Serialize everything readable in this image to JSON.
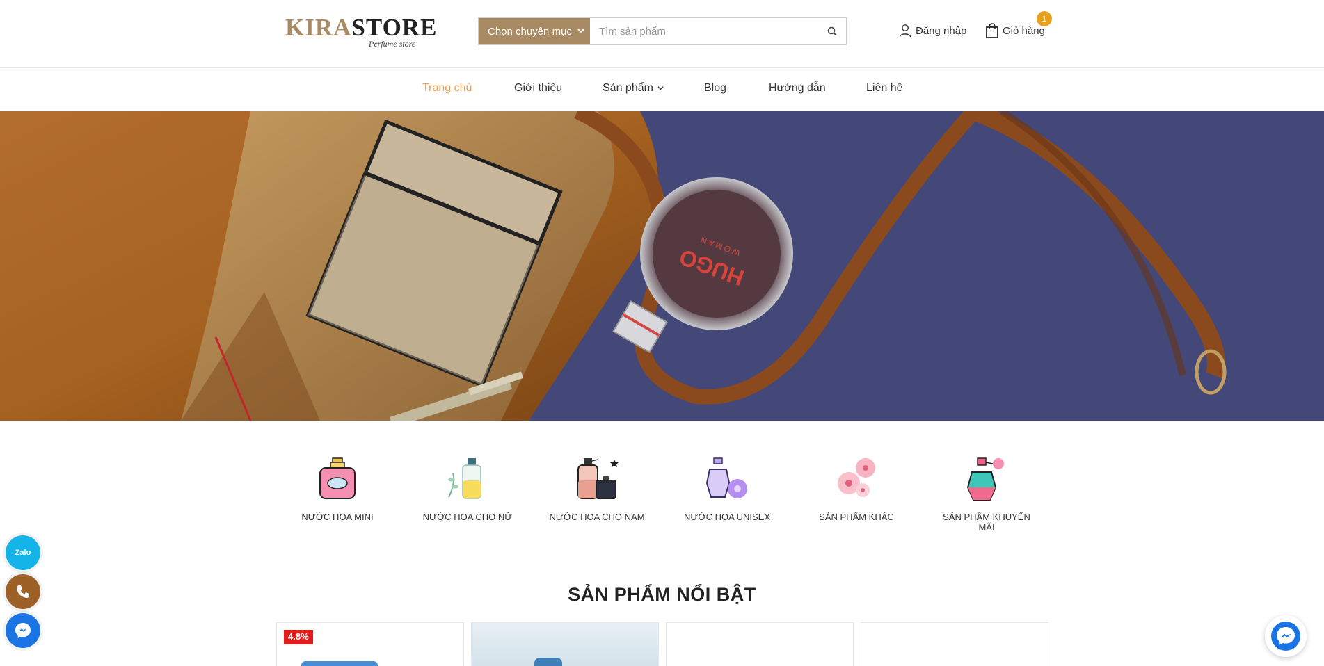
{
  "header": {
    "logo_main_1": "KIRA",
    "logo_main_2": "STORE",
    "logo_sub": "Perfume store",
    "search_category": "Chọn chuyên mục",
    "search_placeholder": "Tìm sản phẩm",
    "login_label": "Đăng nhập",
    "cart_label": "Giỏ hàng",
    "cart_count": "1"
  },
  "nav": {
    "items": [
      {
        "label": "Trang chủ"
      },
      {
        "label": "Giới thiệu"
      },
      {
        "label": "Sản phẩm"
      },
      {
        "label": "Blog"
      },
      {
        "label": "Hướng dẫn"
      },
      {
        "label": "Liên hệ"
      }
    ]
  },
  "hero": {
    "bottle_brand": "HUGO",
    "bottle_sub": "WOMAN"
  },
  "categories": [
    {
      "label": "Nước hoa mini",
      "icon": "perfume-mini-icon"
    },
    {
      "label": "Nước hoa cho nữ",
      "icon": "perfume-women-icon"
    },
    {
      "label": "Nước hoa cho nam",
      "icon": "perfume-men-icon"
    },
    {
      "label": "Nước hoa unisex",
      "icon": "perfume-unisex-icon"
    },
    {
      "label": "Sản phẩm khác",
      "icon": "flowers-icon"
    },
    {
      "label": "Sản phẩm khuyến mãi",
      "icon": "perfume-promo-icon"
    }
  ],
  "featured": {
    "title": "SẢN PHẨM NỔI BẬT",
    "sale_badge": "4.8%"
  },
  "floating": {
    "zalo_label": "Zalo"
  },
  "colors": {
    "brand": "#a88a64",
    "accent": "#e9a35a",
    "badge": "#e8a020"
  }
}
